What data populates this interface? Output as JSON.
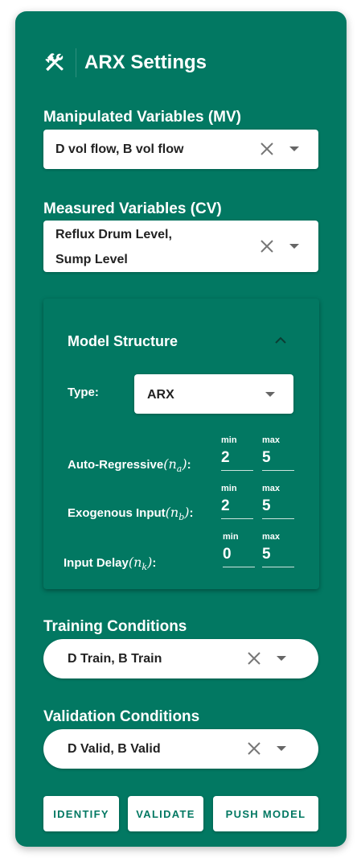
{
  "header": {
    "title": "ARX Settings",
    "icon": "tools-icon"
  },
  "mv": {
    "label": "Manipulated Variables (MV)",
    "value": "D vol flow, B vol flow"
  },
  "cv": {
    "label": "Measured Variables (CV)",
    "value_line1": "Reflux Drum Level,",
    "value_line2": "Sump Level"
  },
  "model_structure": {
    "title": "Model Structure",
    "type_label": "Type:",
    "type_value": "ARX",
    "min_label": "min",
    "max_label": "max",
    "rows": [
      {
        "label": "Auto-Regressive",
        "symbol": "n",
        "sub": "a",
        "min": "2",
        "max": "5"
      },
      {
        "label": "Exogenous Input",
        "symbol": "n",
        "sub": "b",
        "min": "2",
        "max": "5"
      },
      {
        "label": "Input Delay",
        "symbol": "n",
        "sub": "k",
        "min": "0",
        "max": "5"
      }
    ]
  },
  "training": {
    "label": "Training Conditions",
    "value": "D Train, B Train"
  },
  "validation": {
    "label": "Validation Conditions",
    "value": "D Valid, B Valid"
  },
  "buttons": {
    "identify": "IDENTIFY",
    "validate": "VALIDATE",
    "push": "PUSH MODEL"
  },
  "colors": {
    "panel": "#027862",
    "accent_text": "#027862"
  }
}
